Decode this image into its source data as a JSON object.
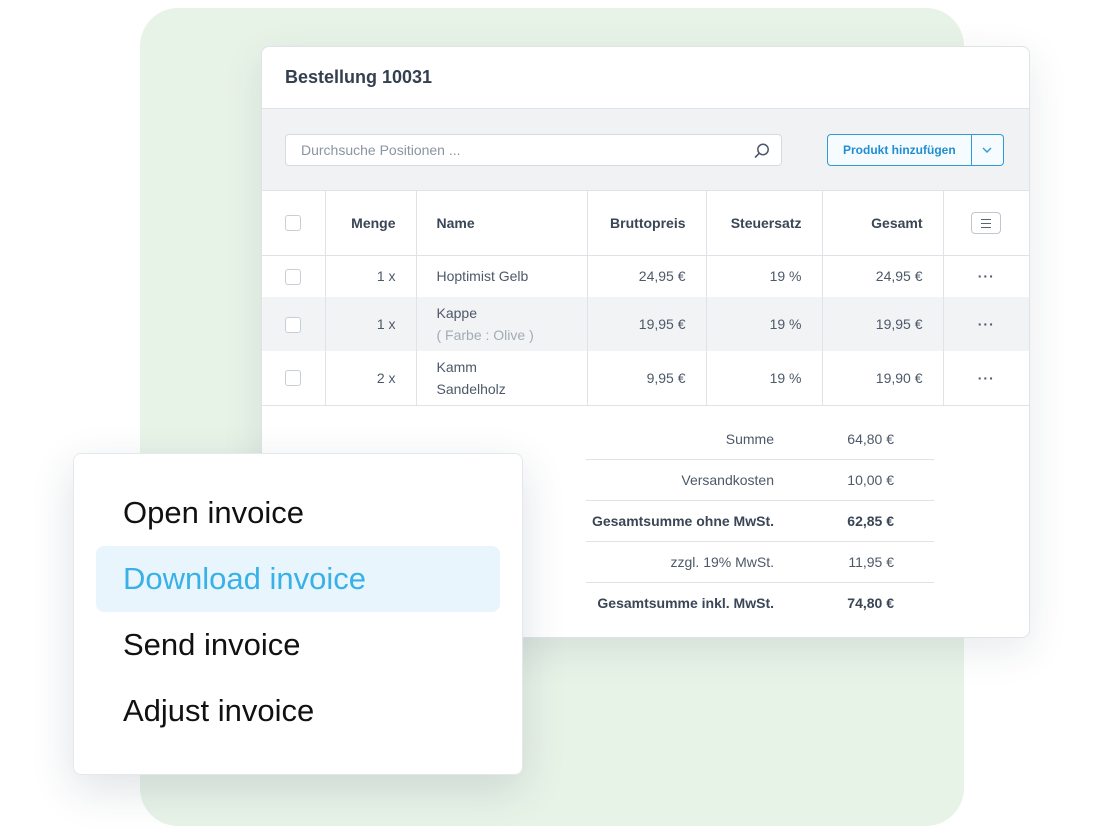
{
  "order": {
    "title": "Bestellung 10031"
  },
  "toolbar": {
    "search_placeholder": "Durchsuche Positionen ...",
    "add_product_label": "Produkt hinzufügen"
  },
  "table": {
    "headers": {
      "quantity": "Menge",
      "name": "Name",
      "gross_price": "Bruttopreis",
      "tax_rate": "Steuersatz",
      "total": "Gesamt"
    },
    "rows": [
      {
        "qty": "1 x",
        "name": "Hoptimist Gelb",
        "sub": "",
        "price": "24,95 €",
        "tax": "19 %",
        "total": "24,95 €",
        "actions": "···"
      },
      {
        "qty": "1 x",
        "name": "Kappe",
        "sub": "( Farbe : Olive )",
        "price": "19,95 €",
        "tax": "19 %",
        "total": "19,95 €",
        "actions": "···"
      },
      {
        "qty": "2 x",
        "name": "Kamm",
        "sub": "Sandelholz",
        "price": "9,95 €",
        "tax": "19 %",
        "total": "19,90 €",
        "actions": "···"
      }
    ]
  },
  "totals": [
    {
      "label": "Summe",
      "value": "64,80 €"
    },
    {
      "label": "Versandkosten",
      "value": "10,00 €"
    },
    {
      "label": "Gesamtsumme ohne MwSt.",
      "value": "62,85 €"
    },
    {
      "label": "zzgl. 19% MwSt.",
      "value": "11,95 €"
    },
    {
      "label": "Gesamtsumme inkl. MwSt.",
      "value": "74,80 €"
    }
  ],
  "menu": {
    "items": [
      {
        "label": "Open invoice"
      },
      {
        "label": "Download invoice"
      },
      {
        "label": "Send invoice"
      },
      {
        "label": "Adjust invoice"
      }
    ]
  },
  "colors": {
    "background_green": "#e8f3e8",
    "accent_blue": "#2f9bd6",
    "menu_highlight": "#e9f5fc",
    "menu_highlight_text": "#38b1e8"
  }
}
